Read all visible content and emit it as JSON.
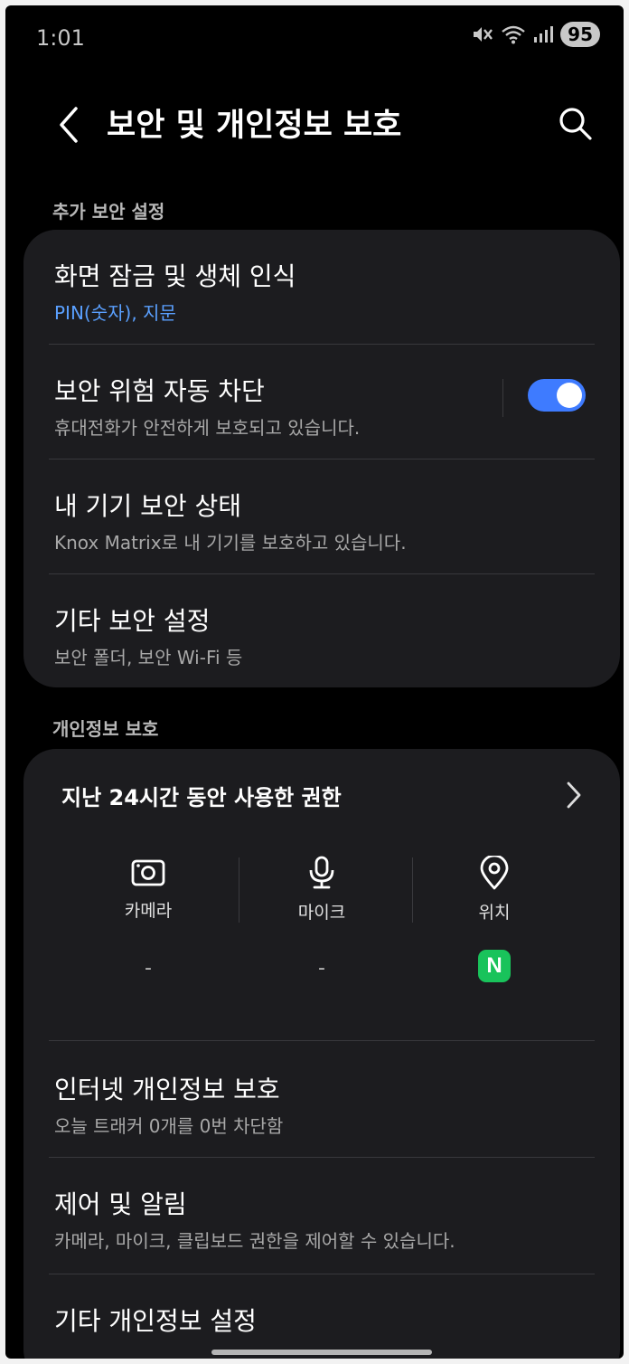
{
  "status_bar": {
    "time": "1:01",
    "battery": "95"
  },
  "header": {
    "title": "보안 및 개인정보 보호"
  },
  "sections": {
    "security": {
      "label": "추가 보안 설정",
      "items": [
        {
          "title": "화면 잠금 및 생체 인식",
          "subtitle": "PIN(숫자), 지문"
        },
        {
          "title": "보안 위험 자동 차단",
          "subtitle": "휴대전화가 안전하게 보호되고 있습니다.",
          "toggle_on": true
        },
        {
          "title": "내 기기 보안 상태",
          "subtitle": "Knox Matrix로 내 기기를 보호하고 있습니다."
        },
        {
          "title": "기타 보안 설정",
          "subtitle": "보안 폴더, 보안 Wi-Fi 등"
        }
      ]
    },
    "privacy": {
      "label": "개인정보 보호",
      "permissions": {
        "title": "지난 24시간 동안 사용한 권한",
        "columns": [
          {
            "label": "카메라",
            "usage": "-"
          },
          {
            "label": "마이크",
            "usage": "-"
          },
          {
            "label": "위치",
            "usage_app": "N"
          }
        ]
      },
      "items": [
        {
          "title": "인터넷 개인정보 보호",
          "subtitle": "오늘 트래커 0개를 0번 차단함"
        },
        {
          "title": "제어 및 알림",
          "subtitle": "카메라, 마이크, 클립보드 권한을 제어할 수 있습니다."
        },
        {
          "title": "기타 개인정보 설정"
        }
      ]
    }
  },
  "colors": {
    "accent": "#3e7bff",
    "link_blue": "#5aa0ff",
    "card_bg": "#1c1c1f",
    "naver_green": "#19c35b"
  }
}
